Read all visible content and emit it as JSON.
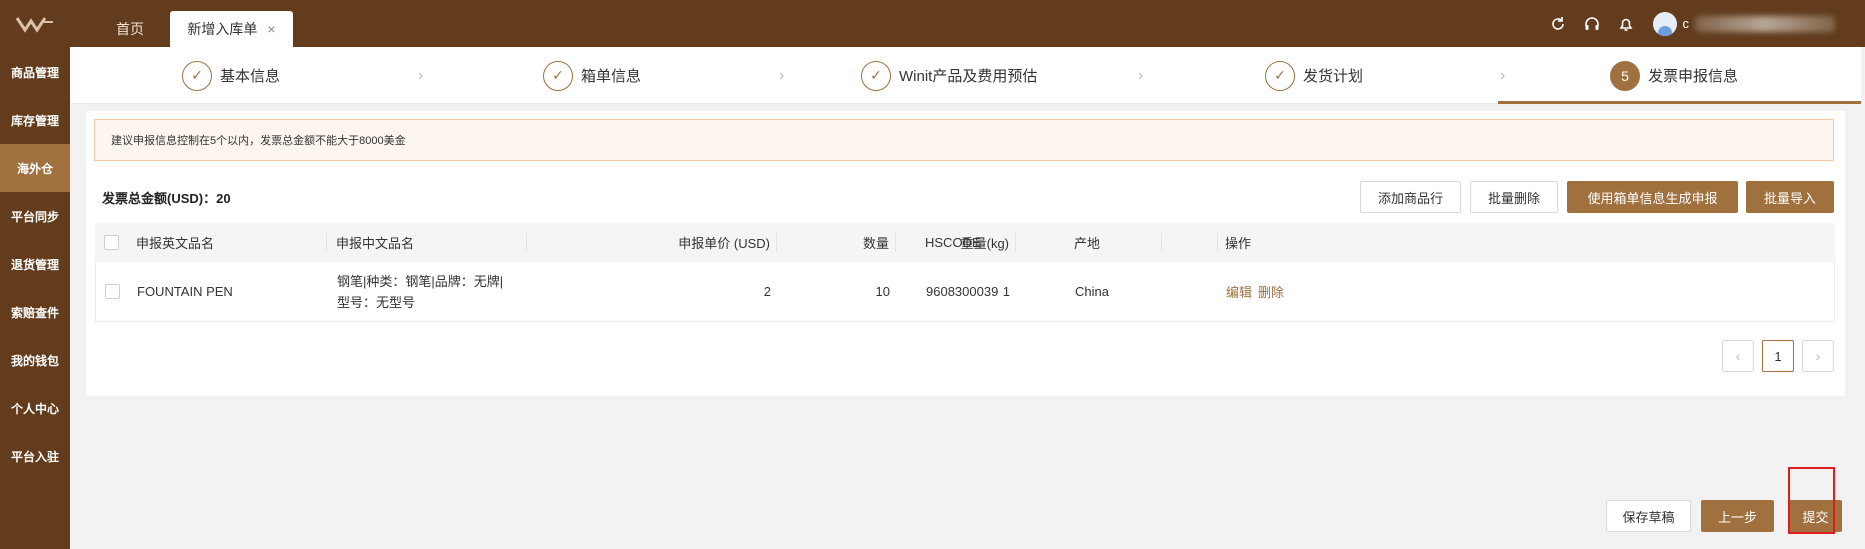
{
  "sidebar": {
    "logo_icon": "winit-logo-icon",
    "items": [
      {
        "label": "商品管理"
      },
      {
        "label": "库存管理"
      },
      {
        "label": "海外仓",
        "active": true
      },
      {
        "label": "平台同步"
      },
      {
        "label": "退货管理"
      },
      {
        "label": "索赔查件"
      },
      {
        "label": "我的钱包"
      },
      {
        "label": "个人中心"
      },
      {
        "label": "平台入驻"
      }
    ]
  },
  "topbar": {
    "tabs": [
      {
        "label": "首页"
      },
      {
        "label": "新增入库单",
        "active": true,
        "close": "×"
      }
    ],
    "icons": [
      "refresh-icon",
      "headset-icon",
      "bell-icon"
    ],
    "user_initial": "c"
  },
  "steps": [
    {
      "label": "基本信息",
      "status": "done"
    },
    {
      "label": "箱单信息",
      "status": "done"
    },
    {
      "label": "Winit产品及费用预估",
      "status": "done"
    },
    {
      "label": "发货计划",
      "status": "done"
    },
    {
      "label": "发票申报信息",
      "status": "current",
      "number": "5"
    }
  ],
  "notice": "建议申报信息控制在5个以内，发票总金额不能大于8000美金",
  "total": {
    "label": "发票总金额(USD)：",
    "value": "20"
  },
  "actions": {
    "add_row": "添加商品行",
    "batch_delete": "批量删除",
    "generate": "使用箱单信息生成申报",
    "batch_import": "批量导入"
  },
  "table": {
    "headers": [
      "申报英文品名",
      "申报中文品名",
      "申报单价 (USD)",
      "数量",
      "重量(kg)",
      "HSCODE",
      "产地",
      "操作"
    ],
    "rows": [
      {
        "en_name": "FOUNTAIN PEN",
        "cn_name_line1": "钢笔|种类：钢笔|品牌：无牌|",
        "cn_name_line2": "型号：无型号",
        "unit_price": "2",
        "quantity": "10",
        "weight": "1",
        "hscode": "9608300039",
        "origin": "China",
        "edit": "编辑",
        "delete": "删除"
      }
    ]
  },
  "pagination": {
    "prev": "‹",
    "current": "1",
    "next": "›"
  },
  "footer": {
    "save_draft": "保存草稿",
    "prev_step": "上一步",
    "submit": "提交"
  }
}
